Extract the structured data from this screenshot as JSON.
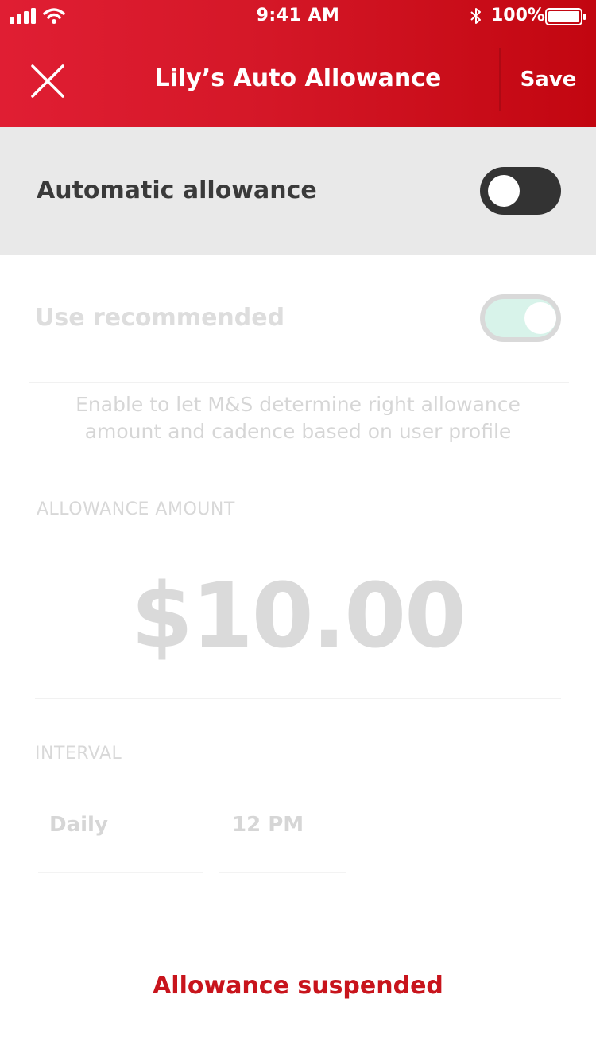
{
  "status_bar": {
    "time": "9:41 AM",
    "battery": "100%"
  },
  "header": {
    "title": "Lily’s Auto Allowance",
    "save_label": "Save",
    "close_icon": "close-icon"
  },
  "automatic_allowance": {
    "label": "Automatic allowance",
    "enabled": false
  },
  "use_recommended": {
    "label": "Use recommended",
    "enabled": true,
    "description": "Enable to let M&S determine right allowance amount and cadence based on user profile"
  },
  "allowance_amount": {
    "label": "ALLOWANCE AMOUNT",
    "value": "$10.00"
  },
  "interval": {
    "label": "INTERVAL",
    "frequency": "Daily",
    "time": "12 PM"
  },
  "footer": {
    "status": "Allowance suspended"
  },
  "colors": {
    "brand_red": "#d41727",
    "toggle_dark": "#333333",
    "toggle_mint": "#d8f3ea",
    "suspended_red": "#c8141c"
  }
}
